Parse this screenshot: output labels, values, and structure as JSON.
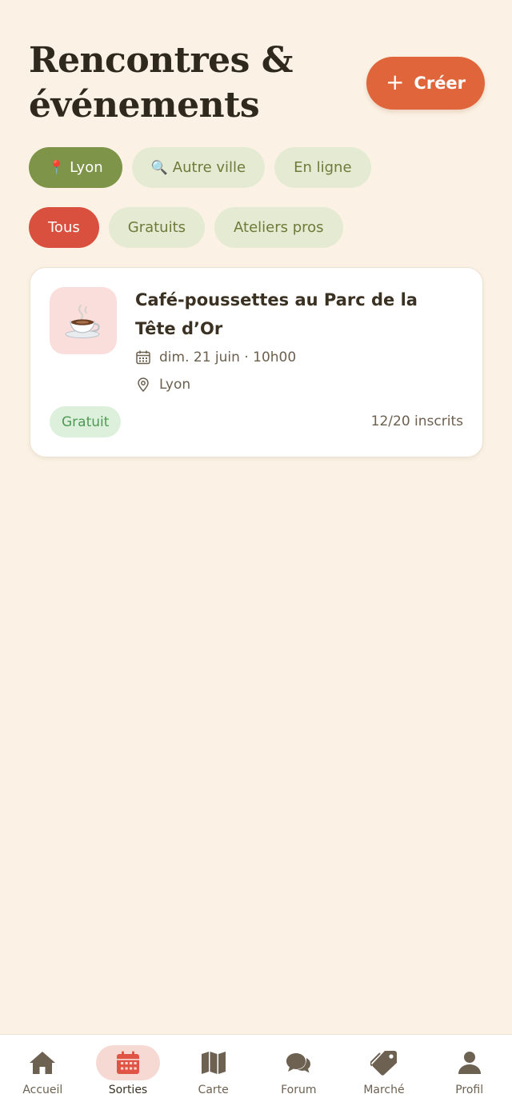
{
  "header": {
    "title": "Rencontres &\névénements",
    "create_label": "Créer",
    "create_icon": "plus-icon"
  },
  "location_chips": [
    {
      "emoji": "📍",
      "label": "Lyon",
      "active": true
    },
    {
      "emoji": "🔍",
      "label": "Autre ville",
      "active": false
    },
    {
      "emoji": "",
      "label": "En ligne",
      "active": false
    }
  ],
  "filter_chips": [
    {
      "label": "Tous",
      "active": true
    },
    {
      "label": "Gratuits",
      "active": false
    },
    {
      "label": "Ateliers pros",
      "active": false
    }
  ],
  "event": {
    "title": "Café-poussettes au Parc de la Tête d’Or",
    "icon": "coffee-cup-icon",
    "date": "dim. 21 juin · 10h00",
    "place": "Lyon",
    "price_badge": "Gratuit",
    "attendees": "12/20 inscrits"
  },
  "bottom_nav": [
    {
      "label": "Accueil",
      "icon": "home-icon",
      "active": false
    },
    {
      "label": "Sorties",
      "icon": "calendar-icon",
      "active": true
    },
    {
      "label": "Carte",
      "icon": "map-icon",
      "active": false
    },
    {
      "label": "Forum",
      "icon": "chat-icon",
      "active": false
    },
    {
      "label": "Marché",
      "icon": "tag-icon",
      "active": false
    },
    {
      "label": "Profil",
      "icon": "user-icon",
      "active": false
    }
  ],
  "colors": {
    "background": "#FBF2E5",
    "accent_orange": "#E0653B",
    "chip_active_green": "#7E9448",
    "chip_active_red": "#D9503F",
    "chip_inactive": "#E5EBD2",
    "nav_active_bg": "#F7D9D3"
  }
}
